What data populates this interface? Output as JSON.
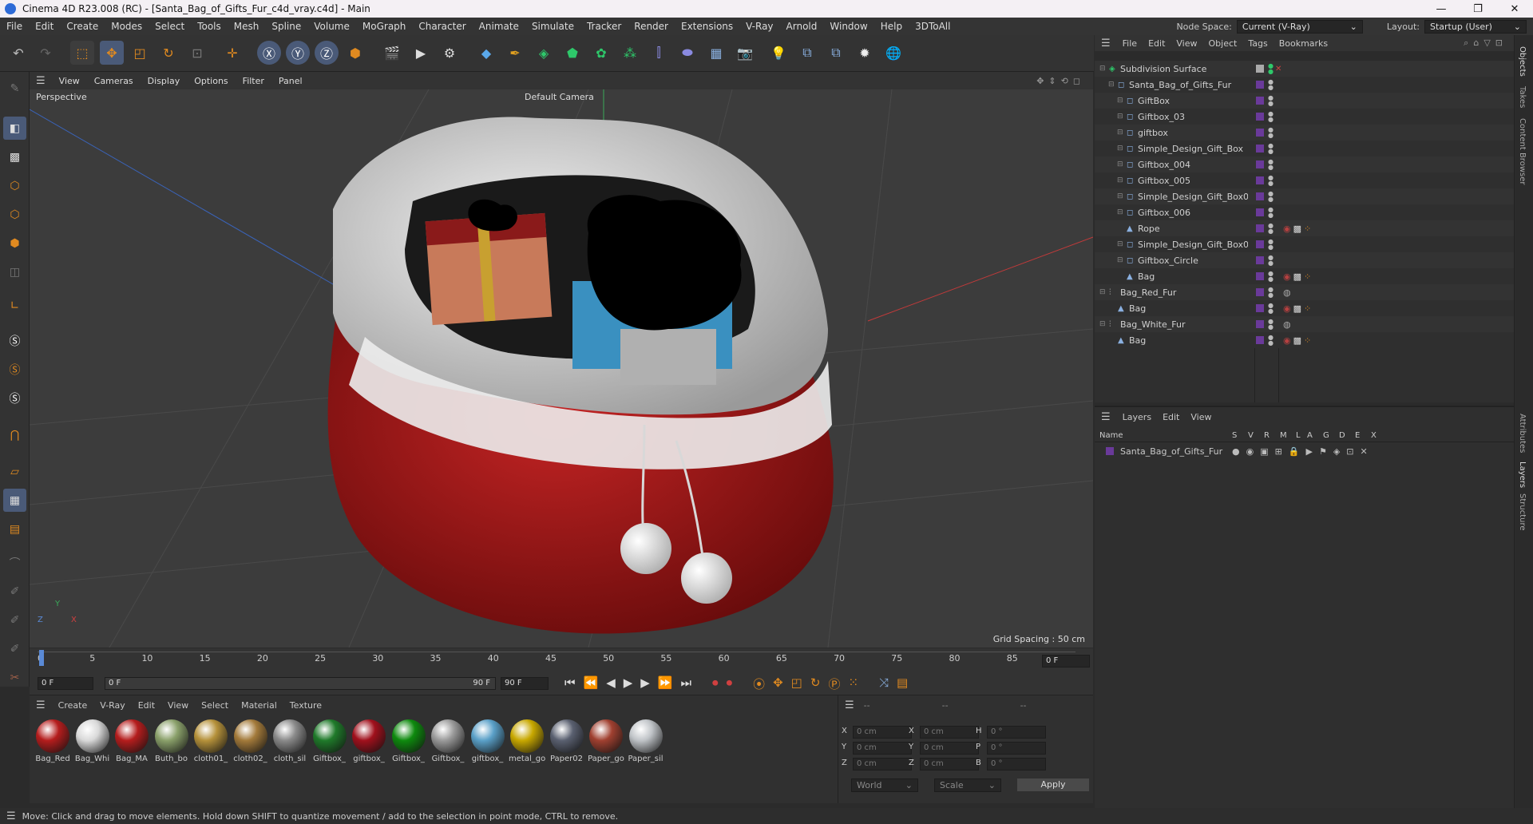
{
  "window": {
    "title": "Cinema 4D R23.008 (RC) - [Santa_Bag_of_Gifts_Fur_c4d_vray.c4d] - Main",
    "controls": [
      "—",
      "❐",
      "✕"
    ]
  },
  "menu": [
    "File",
    "Edit",
    "Create",
    "Modes",
    "Select",
    "Tools",
    "Mesh",
    "Spline",
    "Volume",
    "MoGraph",
    "Character",
    "Animate",
    "Simulate",
    "Tracker",
    "Render",
    "Extensions",
    "V-Ray",
    "Arnold",
    "Window",
    "Help",
    "3DToAll"
  ],
  "nodespace": {
    "label": "Node Space:",
    "value": "Current (V-Ray)"
  },
  "layout": {
    "label": "Layout:",
    "value": "Startup (User)"
  },
  "viewport": {
    "menu": [
      "View",
      "Cameras",
      "Display",
      "Options",
      "Filter",
      "Panel"
    ],
    "name": "Perspective",
    "camera": "Default Camera",
    "grid_spacing": "Grid Spacing : 50 cm",
    "axis": {
      "y": "Y",
      "z": "Z",
      "x": "X"
    }
  },
  "timeline": {
    "ticks": [
      "0",
      "5",
      "10",
      "15",
      "20",
      "25",
      "30",
      "35",
      "40",
      "45",
      "50",
      "55",
      "60",
      "65",
      "70",
      "75",
      "80",
      "85",
      "90"
    ],
    "current": "0 F"
  },
  "transport": {
    "start": "0 F",
    "field": "0 F",
    "end_a": "90 F",
    "end_b": "90 F"
  },
  "materials": {
    "menu": [
      "Create",
      "V-Ray",
      "Edit",
      "View",
      "Select",
      "Material",
      "Texture"
    ],
    "items": [
      {
        "name": "Bag_Red",
        "color": "#b51d1d"
      },
      {
        "name": "Bag_Whi",
        "color": "#d9d9d9"
      },
      {
        "name": "Bag_MA",
        "color": "#b51d1d"
      },
      {
        "name": "Buth_bo",
        "color": "#8aa06a"
      },
      {
        "name": "cloth01_",
        "color": "#b5913a"
      },
      {
        "name": "cloth02_",
        "color": "#a37a3a"
      },
      {
        "name": "cloth_sil",
        "color": "#8a8a8a"
      },
      {
        "name": "Giftbox_",
        "color": "#1f7a2a"
      },
      {
        "name": "giftbox_",
        "color": "#a0101c"
      },
      {
        "name": "Giftbox_",
        "color": "#0e8a0e"
      },
      {
        "name": "Giftbox_",
        "color": "#9a9a9a"
      },
      {
        "name": "giftbox_",
        "color": "#5aa0c8"
      },
      {
        "name": "metal_go",
        "color": "#c8a800"
      },
      {
        "name": "Paper02",
        "color": "#5a6070"
      },
      {
        "name": "Paper_go",
        "color": "#a04030"
      },
      {
        "name": "Paper_sil",
        "color": "#c0c4c8"
      }
    ]
  },
  "coords": {
    "headers": [
      "--",
      "--",
      "--"
    ],
    "rows": [
      {
        "a": "X",
        "av": "0 cm",
        "b": "X",
        "bv": "0 cm",
        "c": "H",
        "cv": "0 °"
      },
      {
        "a": "Y",
        "av": "0 cm",
        "b": "Y",
        "bv": "0 cm",
        "c": "P",
        "cv": "0 °"
      },
      {
        "a": "Z",
        "av": "0 cm",
        "b": "Z",
        "bv": "0 cm",
        "c": "B",
        "cv": "0 °"
      }
    ],
    "world": "World",
    "scale": "Scale",
    "apply": "Apply"
  },
  "objects": {
    "menu": [
      "File",
      "Edit",
      "View",
      "Object",
      "Tags",
      "Bookmarks"
    ],
    "items": [
      {
        "name": "Subdivision Surface",
        "indent": 0,
        "type": "sub"
      },
      {
        "name": "Santa_Bag_of_Gifts_Fur",
        "indent": 1,
        "type": "null"
      },
      {
        "name": "GiftBox",
        "indent": 2,
        "type": "null"
      },
      {
        "name": "Giftbox_03",
        "indent": 2,
        "type": "null"
      },
      {
        "name": "giftbox",
        "indent": 2,
        "type": "null"
      },
      {
        "name": "Simple_Design_Gift_Box",
        "indent": 2,
        "type": "null"
      },
      {
        "name": "Giftbox_004",
        "indent": 2,
        "type": "null"
      },
      {
        "name": "Giftbox_005",
        "indent": 2,
        "type": "null"
      },
      {
        "name": "Simple_Design_Gift_Box001",
        "indent": 2,
        "type": "null"
      },
      {
        "name": "Giftbox_006",
        "indent": 2,
        "type": "null"
      },
      {
        "name": "Rope",
        "indent": 2,
        "type": "poly"
      },
      {
        "name": "Simple_Design_Gift_Box002",
        "indent": 2,
        "type": "null"
      },
      {
        "name": "Giftbox_Circle",
        "indent": 2,
        "type": "null"
      },
      {
        "name": "Bag",
        "indent": 2,
        "type": "poly"
      },
      {
        "name": "Bag_Red_Fur",
        "indent": 0,
        "type": "fur"
      },
      {
        "name": "Bag",
        "indent": 1,
        "type": "poly"
      },
      {
        "name": "Bag_White_Fur",
        "indent": 0,
        "type": "fur"
      },
      {
        "name": "Bag",
        "indent": 1,
        "type": "poly"
      }
    ]
  },
  "layers": {
    "menu": [
      "Layers",
      "Edit",
      "View"
    ],
    "columns": [
      "Name",
      "S",
      "V",
      "R",
      "M",
      "L",
      "A",
      "G",
      "D",
      "E",
      "X"
    ],
    "items": [
      {
        "name": "Santa_Bag_of_Gifts_Fur",
        "color": "#6a3a9a"
      }
    ]
  },
  "right_tabs": [
    "Objects",
    "Takes",
    "Content Browser",
    "Attributes",
    "Layers",
    "Structure"
  ],
  "status": "Move: Click and drag to move elements. Hold down SHIFT to quantize movement / add to the selection in point mode, CTRL to remove.",
  "colors": {
    "accent": "#5a8ad6",
    "orange": "#e08a20",
    "bag_red": "#a91b1b"
  }
}
